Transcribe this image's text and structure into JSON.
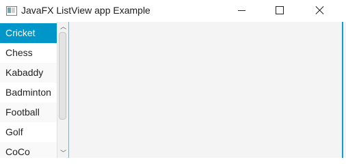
{
  "window": {
    "title": "JavaFX ListView app Example",
    "icon": "javafx-window-icon",
    "controls": [
      "minimize-icon",
      "maximize-icon",
      "close-icon"
    ]
  },
  "listview": {
    "items": [
      "Cricket",
      "Chess",
      "Kabaddy",
      "Badminton",
      "Football",
      "Golf",
      "CoCo"
    ],
    "selected_index": 0,
    "selected_label": "Cricket"
  },
  "colors": {
    "selection": "#0096c9",
    "background": "#f4f4f4",
    "accent_edge": "#0aa0d0"
  }
}
